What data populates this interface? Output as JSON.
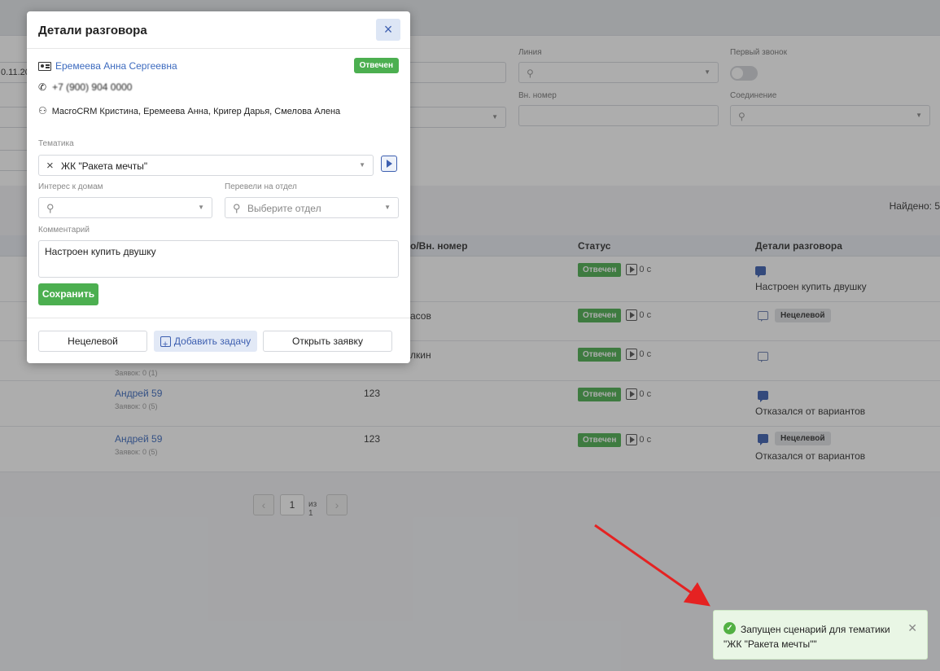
{
  "background": {
    "date_fragment": "0.11.20",
    "filters": {
      "line_label": "Линия",
      "first_call_label": "Первый звонок",
      "ext_number_label": "Вн. номер",
      "connection_label": "Соединение"
    },
    "found_label": "Найдено: 5",
    "table": {
      "headers": {
        "number": "о/Вн. номер",
        "status": "Статус",
        "details": "Детали разговора"
      },
      "rows": [
        {
          "name": "",
          "sub": "",
          "number": "",
          "status": "Отвечен",
          "duration": "0 с",
          "tag": "",
          "detail": "Настроен купить двушку"
        },
        {
          "name": "",
          "sub": "",
          "number": "асов",
          "status": "Отвечен",
          "duration": "0 с",
          "tag": "Нецелевой",
          "detail": ""
        },
        {
          "name": "",
          "sub": "Заявок: 0 (1)",
          "number": "лкин",
          "status": "Отвечен",
          "duration": "0 с",
          "tag": "",
          "detail": ""
        },
        {
          "name": "Андрей 59",
          "sub": "Заявок: 0 (5)",
          "number": "123",
          "status": "Отвечен",
          "duration": "0 с",
          "tag": "",
          "detail": "Отказался от вариантов"
        },
        {
          "name": "Андрей 59",
          "sub": "Заявок: 0 (5)",
          "number": "123",
          "status": "Отвечен",
          "duration": "0 с",
          "tag": "Нецелевой",
          "detail": "Отказался от вариантов"
        }
      ]
    },
    "pagination": {
      "page": "1",
      "of": "из 1"
    }
  },
  "modal": {
    "title": "Детали разговора",
    "close_icon": "×",
    "contact_name": "Еремеева Анна Сергеевна",
    "status_badge": "Отвечен",
    "phone": "+7 (900) 904 0000",
    "operators": "MacroCRM Кристина, Еремеева Анна, Кригер Дарья, Смелова Алена",
    "topic": {
      "label": "Тематика",
      "value": "ЖК \"Ракета мечты\""
    },
    "interest": {
      "label": "Интерес к домам",
      "placeholder": ""
    },
    "department": {
      "label": "Перевели на отдел",
      "placeholder": "Выберите отдел"
    },
    "comment": {
      "label": "Комментарий",
      "value": "Настроен купить двушку"
    },
    "save_label": "Сохранить",
    "footer": {
      "non_target": "Нецелевой",
      "add_task": "Добавить задачу",
      "open_request": "Открыть заявку"
    }
  },
  "toast": {
    "message": "Запущен сценарий для тематики \"ЖК \"Ракета мечты\"\"",
    "icon": "check-circle-icon"
  },
  "colors": {
    "accent": "#3d5fb0",
    "success": "#4caf50",
    "toast_bg": "#e9f6e5",
    "arrow": "#e52222"
  }
}
